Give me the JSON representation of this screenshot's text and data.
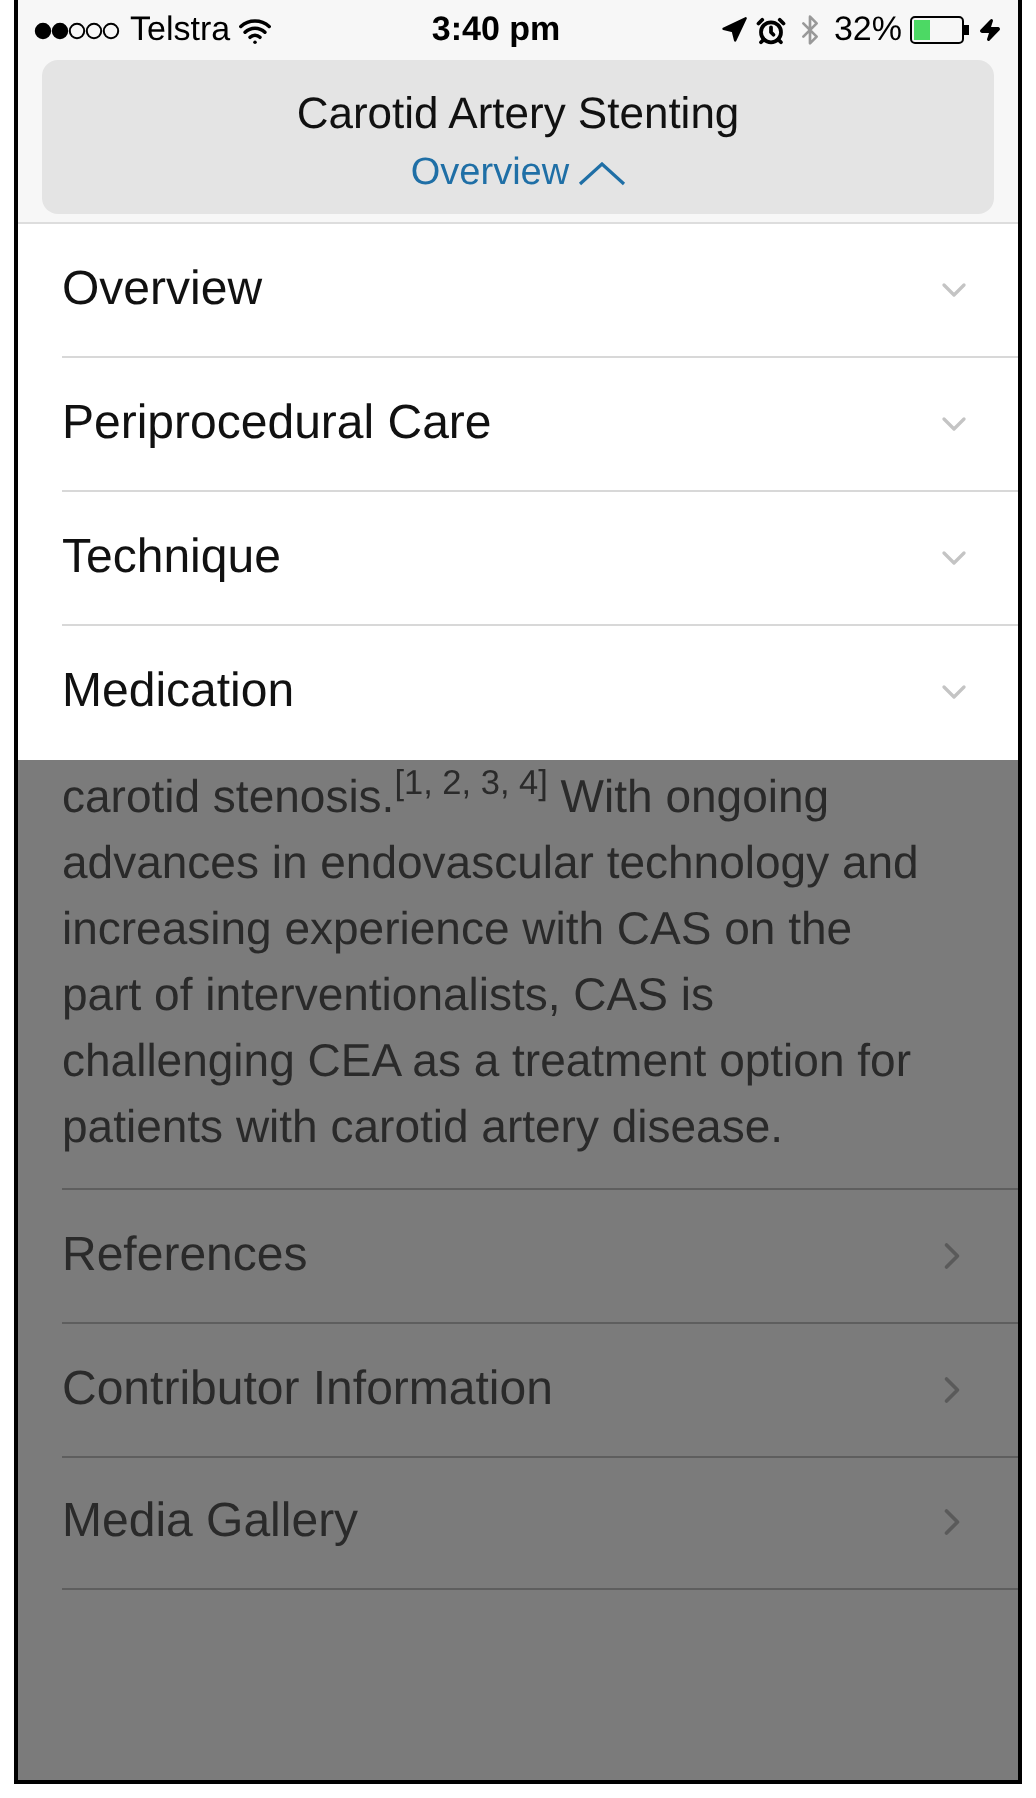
{
  "status_bar": {
    "carrier": "Telstra",
    "time": "3:40 pm",
    "battery": "32%"
  },
  "header": {
    "title": "Carotid Artery Stenting",
    "section": "Overview",
    "expanded": true
  },
  "dropdown": {
    "items": [
      {
        "label": "Overview"
      },
      {
        "label": "Periprocedural Care"
      },
      {
        "label": "Technique"
      },
      {
        "label": "Medication"
      }
    ]
  },
  "article": {
    "paragraph": "carotid stenosis.$^{[1, 2, 3, 4]}$ With ongoing advances in endovascular technology and increasing experience with CAS on the part of interventionalists, CAS is challenging CEA as a treatment option for patients with carotid artery disease."
  },
  "links": [
    {
      "label": "References"
    },
    {
      "label": "Contributor Information"
    },
    {
      "label": "Media Gallery"
    }
  ]
}
